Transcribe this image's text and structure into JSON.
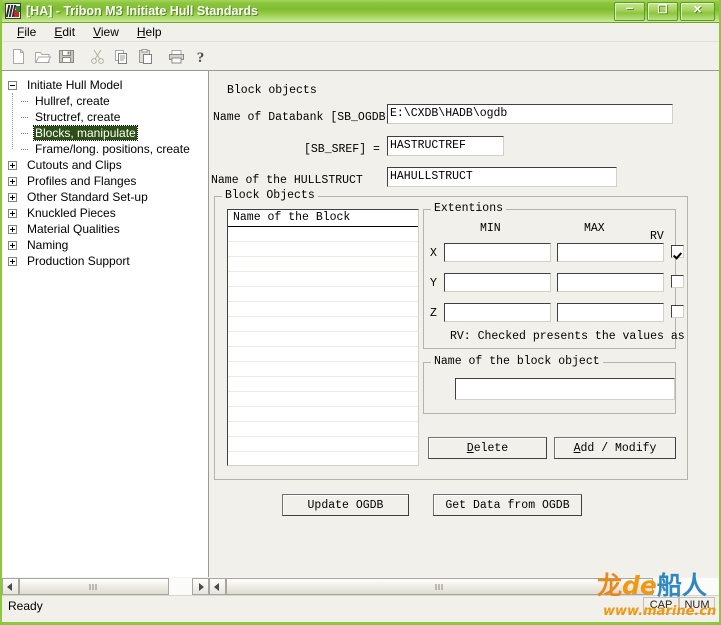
{
  "window": {
    "title": "[HA] - Tribon M3 Initiate Hull Standards",
    "icon": "tribon-app-icon",
    "buttons": {
      "minimize": "–",
      "restore": "❐",
      "close": "✕"
    }
  },
  "menubar": {
    "items": [
      {
        "label": "File",
        "accel": "F"
      },
      {
        "label": "Edit",
        "accel": "E"
      },
      {
        "label": "View",
        "accel": "V"
      },
      {
        "label": "Help",
        "accel": "H"
      }
    ]
  },
  "toolbar": {
    "buttons": [
      {
        "name": "new-icon",
        "tip": "New"
      },
      {
        "name": "open-icon",
        "tip": "Open"
      },
      {
        "name": "save-icon",
        "tip": "Save"
      },
      {
        "name": "cut-icon",
        "tip": "Cut"
      },
      {
        "name": "copy-icon",
        "tip": "Copy"
      },
      {
        "name": "paste-icon",
        "tip": "Paste"
      },
      {
        "name": "print-icon",
        "tip": "Print"
      },
      {
        "name": "help-icon",
        "tip": "Help"
      }
    ]
  },
  "sidebar": {
    "items": [
      {
        "label": "Initiate Hull Model",
        "state": "expanded",
        "level": 0
      },
      {
        "label": "Hullref, create",
        "state": "leaf",
        "level": 1
      },
      {
        "label": "Structref, create",
        "state": "leaf",
        "level": 1
      },
      {
        "label": "Blocks, manipulate",
        "state": "leaf",
        "level": 1,
        "selected": true
      },
      {
        "label": "Frame/long. positions, create",
        "state": "leaf",
        "level": 1
      },
      {
        "label": "Cutouts and Clips",
        "state": "collapsed",
        "level": 0
      },
      {
        "label": "Profiles and Flanges",
        "state": "collapsed",
        "level": 0
      },
      {
        "label": "Other Standard Set-up",
        "state": "collapsed",
        "level": 0
      },
      {
        "label": "Knuckled Pieces",
        "state": "collapsed",
        "level": 0
      },
      {
        "label": "Material Qualities",
        "state": "collapsed",
        "level": 0
      },
      {
        "label": "Naming",
        "state": "collapsed",
        "level": 0
      },
      {
        "label": "Production Support",
        "state": "collapsed",
        "level": 0
      }
    ]
  },
  "form": {
    "heading": "Block objects",
    "databank_label": "Name of Databank [SB_OGDB]",
    "databank_value": "E:\\CXDB\\HADB\\ogdb",
    "sref_label": "[SB_SREF] =",
    "sref_value": "HASTRUCTREF",
    "hullstruct_label": "Name of the HULLSTRUCT",
    "hullstruct_value": "HAHULLSTRUCT",
    "block_objects_group": "Block Objects",
    "listbox_header": "Name of the Block",
    "listbox_items": [],
    "extentions": {
      "title": "Extentions",
      "col_min": "MIN",
      "col_max": "MAX",
      "col_rv": "RV",
      "rows": [
        {
          "axis": "X",
          "min": "",
          "max": "",
          "rv": true
        },
        {
          "axis": "Y",
          "min": "",
          "max": "",
          "rv": false
        },
        {
          "axis": "Z",
          "min": "",
          "max": "",
          "rv": false
        }
      ],
      "note": "RV: Checked presents the values as"
    },
    "name_group_title": "Name of the block object",
    "name_value": "",
    "buttons": {
      "delete": "Delete",
      "delete_accel": "D",
      "add_modify": "Add / Modify",
      "add_modify_accel": "A",
      "update_ogdb": "Update OGDB",
      "get_data": "Get Data from OGDB"
    }
  },
  "statusbar": {
    "text": "Ready",
    "panels": [
      "CAP",
      "NUM"
    ]
  },
  "watermark": {
    "char1": "龙",
    "de": "de",
    "char2": "船人",
    "url": "www.marine.cn"
  },
  "colors": {
    "titlebar_green": "#8cc63f",
    "selection": "#2c4f16",
    "face": "#f1f0ea",
    "field": "#ffffff"
  }
}
